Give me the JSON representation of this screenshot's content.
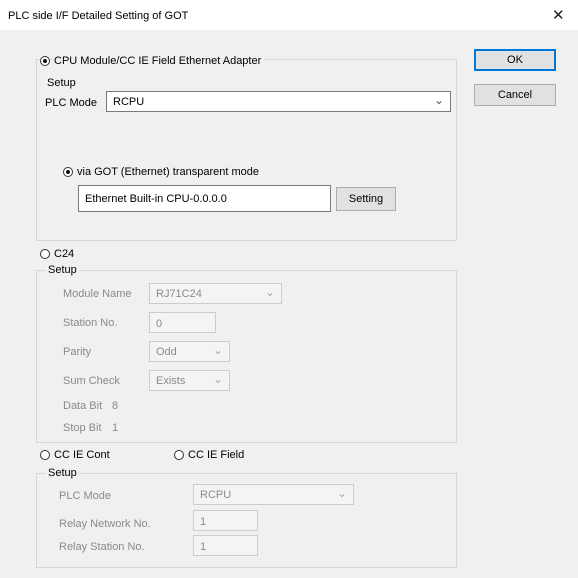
{
  "window": {
    "title": "PLC side I/F Detailed Setting of GOT",
    "close_glyph": "✕"
  },
  "buttons": {
    "ok": "OK",
    "cancel": "Cancel"
  },
  "cpu": {
    "radio_label": "CPU Module/CC IE Field Ethernet Adapter",
    "selected": true,
    "setup_label": "Setup",
    "plc_mode_label": "PLC Mode",
    "plc_mode_value": "RCPU",
    "via_label": "via GOT (Ethernet) transparent mode",
    "via_selected": true,
    "via_value": "Ethernet Built-in CPU-0.0.0.0",
    "setting_button": "Setting"
  },
  "c24": {
    "radio_label": "C24",
    "selected": false,
    "setup_label": "Setup",
    "module_name_label": "Module Name",
    "module_name_value": "RJ71C24",
    "station_no_label": "Station No.",
    "station_no_value": "0",
    "parity_label": "Parity",
    "parity_value": "Odd",
    "sum_check_label": "Sum Check",
    "sum_check_value": "Exists",
    "data_bit_label": "Data Bit",
    "data_bit_value": "8",
    "stop_bit_label": "Stop Bit",
    "stop_bit_value": "1"
  },
  "ccie": {
    "cont_label": "CC IE Cont",
    "field_label": "CC IE Field",
    "cont_selected": false,
    "field_selected": false,
    "setup_label": "Setup",
    "plc_mode_label": "PLC Mode",
    "plc_mode_value": "RCPU",
    "relay_network_label": "Relay Network No.",
    "relay_network_value": "1",
    "relay_station_label": "Relay Station No.",
    "relay_station_value": "1"
  },
  "icons": {
    "dropdown": "chevron-down-icon",
    "close": "close-icon"
  }
}
